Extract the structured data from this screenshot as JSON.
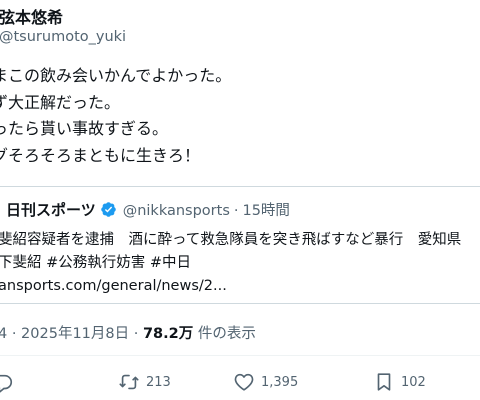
{
  "author": {
    "name": "弦本悠希",
    "handle": "@tsurumoto_yuki"
  },
  "post": {
    "lines": [
      "まこの飲み会いかんでよかった。",
      "ず大正解だった。",
      "ったら貰い事故すぎる。",
      "グそろそろまともに生きろ！"
    ]
  },
  "quote": {
    "name": "日刊スポーツ",
    "handle": "@nikkansports",
    "separator": "·",
    "time": "15時間",
    "lines": [
      "斐紹容疑者を逮捕　酒に酔って救急隊員を突き飛ばすなど暴行　愛知県",
      "下斐紹 #公務執行妨害 #中日",
      "ansports.com/general/news/2..."
    ]
  },
  "meta": {
    "time_date": "4 · 2025年11月8日 · ",
    "views": "78.2万",
    "views_suffix": " 件の表示"
  },
  "actions": {
    "retweets": "213",
    "likes": "1,395",
    "bookmarks": "102"
  },
  "colors": {
    "text": "#0f1419",
    "secondary": "#536471",
    "border": "#cfd9de",
    "verified": "#1d9bf0"
  }
}
